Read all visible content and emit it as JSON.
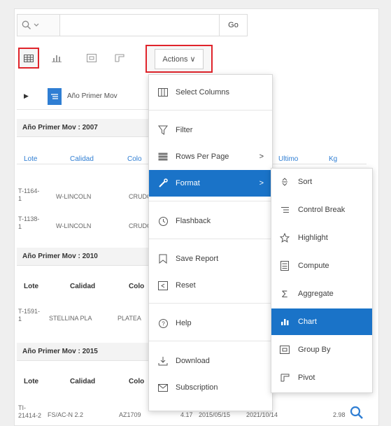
{
  "search": {
    "go_label": "Go"
  },
  "actions": {
    "label": "Actions ∨"
  },
  "control_break": {
    "label": "Año Primer Mov"
  },
  "groups": [
    {
      "header": "Año Primer Mov : 2007",
      "columns": [
        "Lote",
        "Calidad",
        "Colo"
      ],
      "rows": [
        {
          "lote": "T-1164-\n1",
          "calidad": "W-LINCOLN",
          "color": "CRUDO"
        },
        {
          "lote": "T-1138-\n1",
          "calidad": "W-LINCOLN",
          "color": "CRUDO"
        }
      ]
    },
    {
      "header": "Año Primer Mov : 2010",
      "columns": [
        "Lote",
        "Calidad",
        "Colo"
      ],
      "rows": [
        {
          "lote": "T-1591-\n1",
          "calidad": "STELLINA PLA",
          "color": "PLATEA"
        }
      ]
    },
    {
      "header": "Año Primer Mov : 2015",
      "columns": [
        "Lote",
        "Calidad",
        "Colo"
      ],
      "rows": [
        {
          "lote": "TI-\n21414-2",
          "calidad": "FS/AC-N 2.2",
          "color": "AZ1709",
          "v1": "4.17",
          "fecha1": "2015/05/15",
          "fecha2": "2021/10/14",
          "kg": "2.98"
        }
      ]
    }
  ],
  "extra_columns": {
    "ultimo": "Ultimo",
    "kg": "Kg"
  },
  "menu": [
    {
      "label": "Select Columns",
      "icon": "columns-icon"
    },
    {
      "label": "Filter",
      "icon": "filter-icon"
    },
    {
      "label": "Rows Per Page",
      "icon": "rows-icon",
      "arrow": ">"
    },
    {
      "label": "Format",
      "icon": "format-icon",
      "arrow": ">",
      "active": true
    },
    {
      "label": "Flashback",
      "icon": "flashback-icon"
    },
    {
      "label": "Save Report",
      "icon": "save-icon"
    },
    {
      "label": "Reset",
      "icon": "reset-icon"
    },
    {
      "label": "Help",
      "icon": "help-icon"
    },
    {
      "label": "Download",
      "icon": "download-icon"
    },
    {
      "label": "Subscription",
      "icon": "subscription-icon"
    }
  ],
  "submenu": [
    {
      "label": "Sort",
      "icon": "sort-icon"
    },
    {
      "label": "Control Break",
      "icon": "control-break-icon"
    },
    {
      "label": "Highlight",
      "icon": "highlight-icon"
    },
    {
      "label": "Compute",
      "icon": "compute-icon"
    },
    {
      "label": "Aggregate",
      "icon": "aggregate-icon"
    },
    {
      "label": "Chart",
      "icon": "chart-icon",
      "active": true
    },
    {
      "label": "Group By",
      "icon": "group-by-icon"
    },
    {
      "label": "Pivot",
      "icon": "pivot-icon"
    }
  ],
  "colors": {
    "accent": "#1a73c8",
    "highlight_border": "#e0242b",
    "chip": "#2f7ed3"
  }
}
